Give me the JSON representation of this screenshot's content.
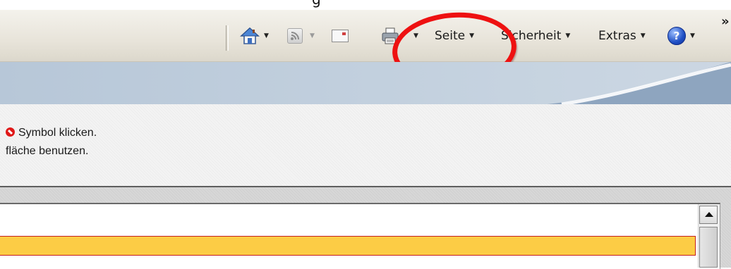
{
  "caption": {
    "cut_text": "g"
  },
  "toolbar": {
    "items": [
      {
        "label": "Seite"
      },
      {
        "label": "Sicherheit"
      },
      {
        "label": "Extras"
      }
    ],
    "dropdown_glyph": "▼",
    "help_glyph": "?",
    "overflow_glyph": "»"
  },
  "info": {
    "line1": "Symbol klicken.",
    "line2": "fläche benutzen."
  },
  "colors": {
    "annotation": "#ee1111",
    "highlight_row": "#fccc45",
    "highlight_border": "#c41f1f",
    "header_band": "#c6d3e0"
  },
  "icons": [
    "home-icon",
    "feeds-icon",
    "mail-icon",
    "print-icon",
    "help-icon",
    "stop-icon",
    "scroll-up-icon"
  ]
}
